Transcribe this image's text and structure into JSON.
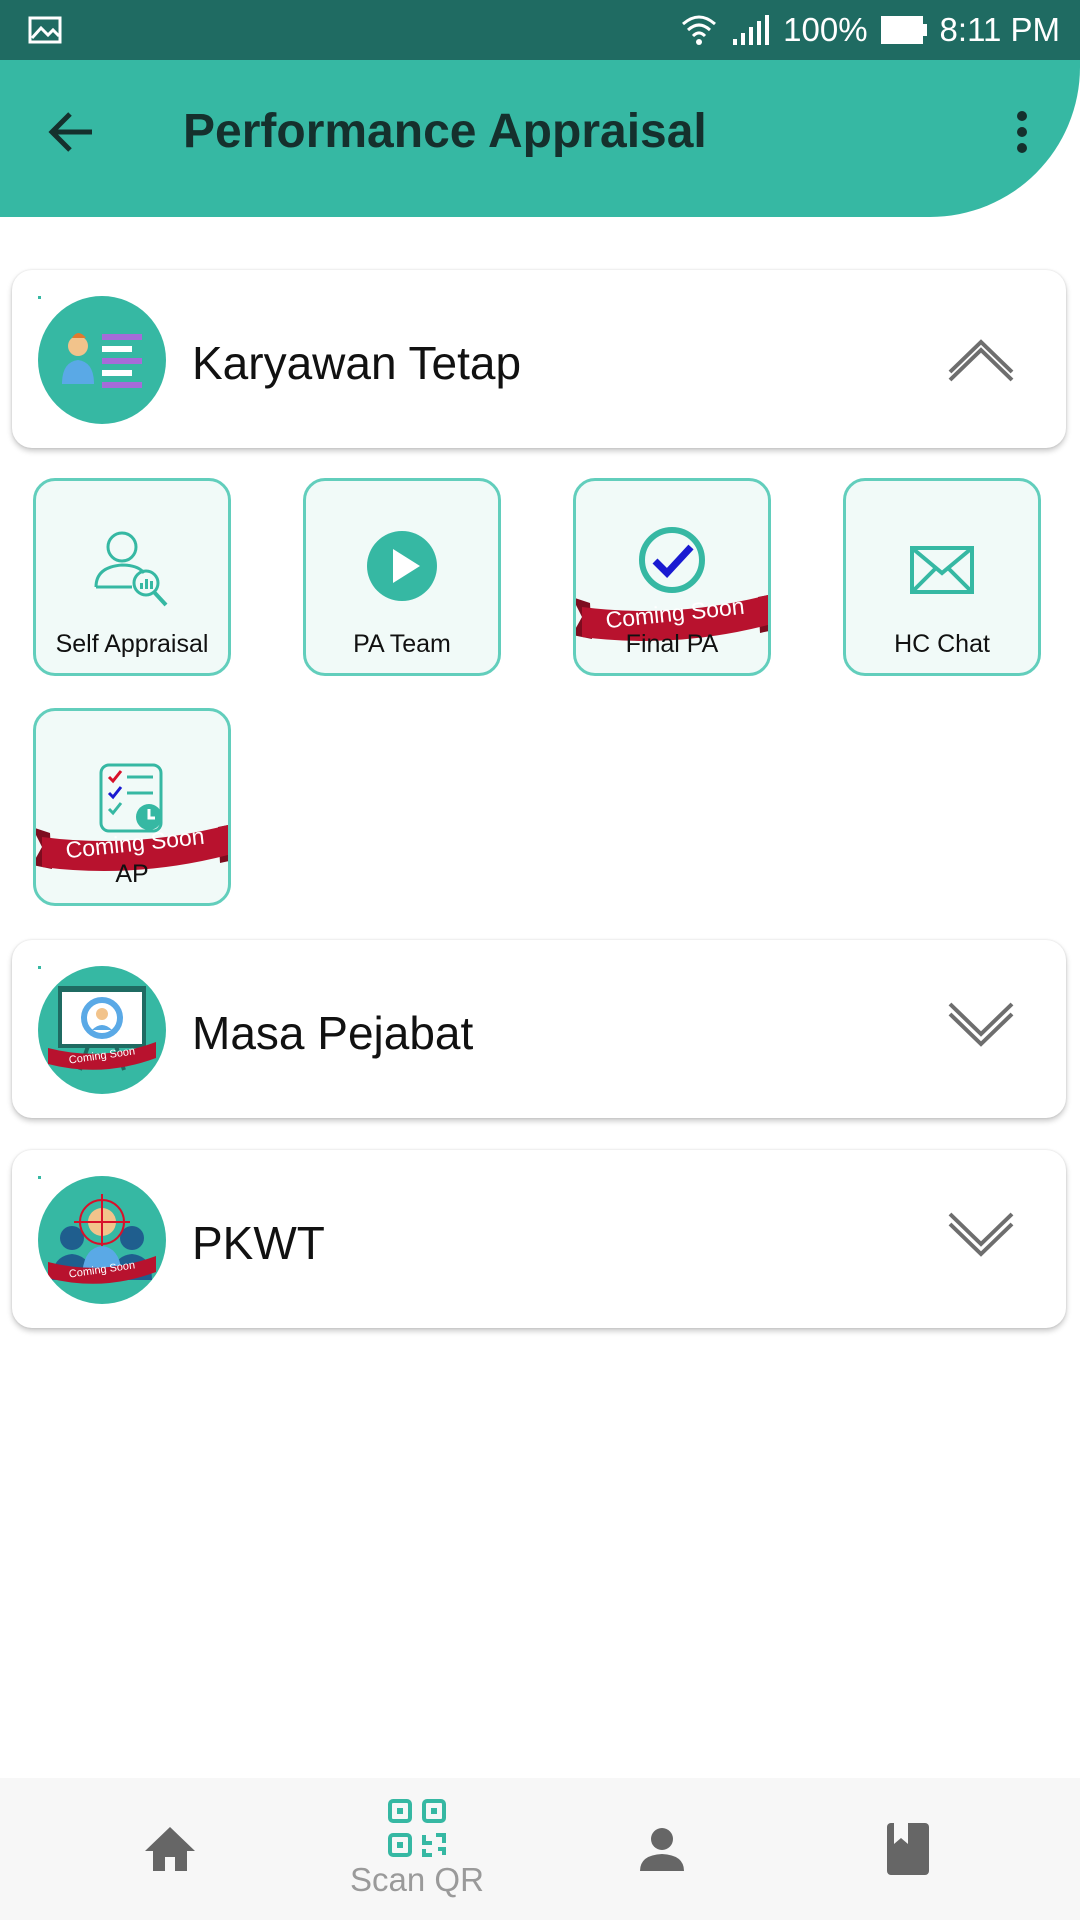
{
  "status_bar": {
    "battery": "100%",
    "time": "8:11 PM"
  },
  "app_bar": {
    "title": "Performance Appraisal"
  },
  "sections": [
    {
      "title": "Karyawan Tetap",
      "expanded": true
    },
    {
      "title": "Masa Pejabat",
      "expanded": false,
      "badge": "Coming Soon"
    },
    {
      "title": "PKWT",
      "expanded": false,
      "badge": "Coming Soon"
    }
  ],
  "menu": [
    {
      "label": "Self Appraisal",
      "icon": "user-search-icon"
    },
    {
      "label": "PA Team",
      "icon": "play-icon"
    },
    {
      "label": "Final PA",
      "icon": "check-circle-icon",
      "ribbon": "Coming Soon"
    },
    {
      "label": "HC Chat",
      "icon": "envelope-icon"
    },
    {
      "label": "AP",
      "icon": "checklist-clock-icon",
      "ribbon": "Coming Soon"
    }
  ],
  "bottom_nav": {
    "scan_label": "Scan QR"
  },
  "colors": {
    "primary": "#36b8a3",
    "status_bar": "#1f6b62",
    "ribbon": "#b8122e"
  }
}
